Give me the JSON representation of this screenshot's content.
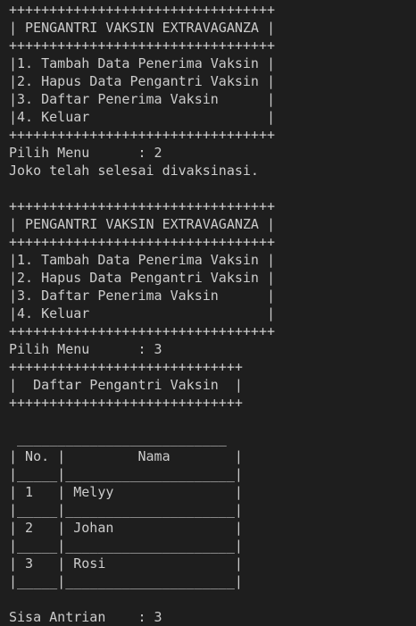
{
  "terminal": {
    "lines": [
      "+++++++++++++++++++++++++++++++++",
      "| PENGANTRI VAKSIN EXTRAVAGANZA |",
      "+++++++++++++++++++++++++++++++++",
      "|1. Tambah Data Penerima Vaksin |",
      "|2. Hapus Data Pengantri Vaksin |",
      "|3. Daftar Penerima Vaksin      |",
      "|4. Keluar                      |",
      "+++++++++++++++++++++++++++++++++",
      "Pilih Menu      : 2",
      "Joko telah selesai divaksinasi.",
      "",
      "+++++++++++++++++++++++++++++++++",
      "| PENGANTRI VAKSIN EXTRAVAGANZA |",
      "+++++++++++++++++++++++++++++++++",
      "|1. Tambah Data Penerima Vaksin |",
      "|2. Hapus Data Pengantri Vaksin |",
      "|3. Daftar Penerima Vaksin      |",
      "|4. Keluar                      |",
      "+++++++++++++++++++++++++++++++++",
      "Pilih Menu      : 3",
      "+++++++++++++++++++++++++++++",
      "|  Daftar Pengantri Vaksin  |",
      "+++++++++++++++++++++++++++++",
      "",
      " __________________________",
      "| No. |         Nama        |",
      "|_____|_____________________|",
      "| 1   | Melyy               |",
      "|_____|_____________________|",
      "| 2   | Johan               |",
      "|_____|_____________________|",
      "| 3   | Rosi                |",
      "|_____|_____________________|",
      "",
      "Sisa Antrian    : 3"
    ]
  }
}
